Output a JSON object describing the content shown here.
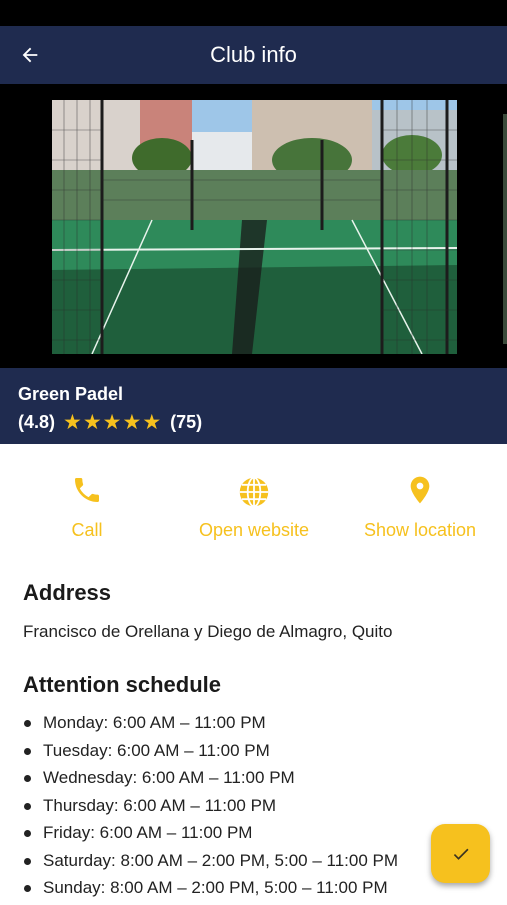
{
  "appbar": {
    "title": "Club info",
    "back_icon": "arrow-left-icon"
  },
  "gallery": {
    "photo_description_icon": "padel-court-photo"
  },
  "club": {
    "name": "Green Padel",
    "rating_value": "(4.8)",
    "rating_stars": 5,
    "review_count": "(75)"
  },
  "actions": [
    {
      "label": "Call",
      "icon": "phone-icon"
    },
    {
      "label": "Open website",
      "icon": "globe-icon"
    },
    {
      "label": "Show location",
      "icon": "location-pin-icon"
    }
  ],
  "address": {
    "title": "Address",
    "text": "Francisco de Orellana y Diego de Almagro, Quito"
  },
  "schedule": {
    "title": "Attention schedule",
    "items": [
      "Monday: 6:00 AM – 11:00 PM",
      "Tuesday: 6:00 AM – 11:00 PM",
      "Wednesday: 6:00 AM – 11:00 PM",
      "Thursday: 6:00 AM – 11:00 PM",
      "Friday: 6:00 AM – 11:00 PM",
      "Saturday: 8:00 AM – 2:00 PM, 5:00 – 11:00 PM",
      "Sunday: 8:00 AM – 2:00 PM, 5:00 – 11:00 PM"
    ]
  },
  "fab": {
    "icon": "check-icon"
  },
  "colors": {
    "primary": "#1f2b4f",
    "accent": "#f6c11e",
    "court_green": "#2e8a5a"
  }
}
